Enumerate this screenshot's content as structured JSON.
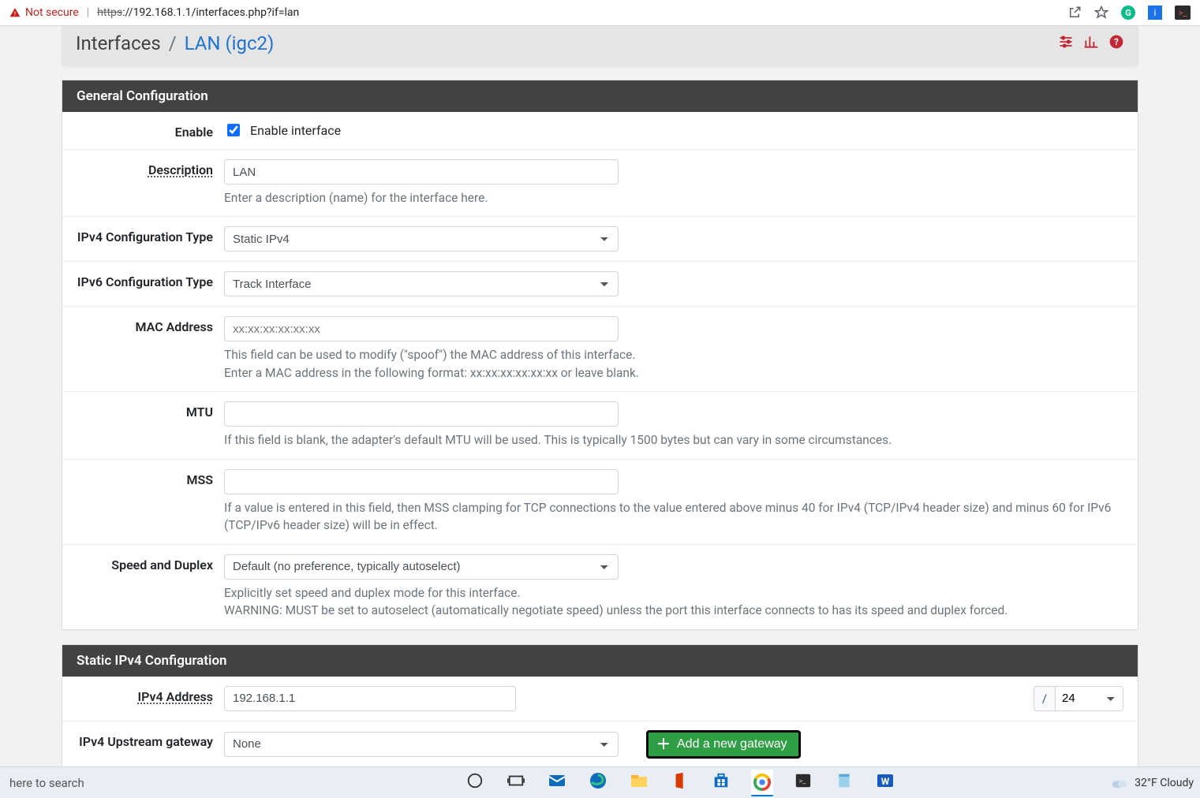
{
  "browser": {
    "security_text": "Not secure",
    "scheme": "https",
    "url_rest": "://192.168.1.1/interfaces.php?if=lan"
  },
  "breadcrumb": {
    "root": "Interfaces",
    "sep": "/",
    "current": "LAN (igc2)"
  },
  "panels": {
    "general": {
      "title": "General Configuration",
      "enable": {
        "label": "Enable",
        "checkbox_label": "Enable interface",
        "checked": true
      },
      "description": {
        "label": "Description",
        "value": "LAN",
        "help": "Enter a description (name) for the interface here."
      },
      "ipv4type": {
        "label": "IPv4 Configuration Type",
        "value": "Static IPv4"
      },
      "ipv6type": {
        "label": "IPv6 Configuration Type",
        "value": "Track Interface"
      },
      "mac": {
        "label": "MAC Address",
        "placeholder": "xx:xx:xx:xx:xx:xx",
        "help1": "This field can be used to modify (\"spoof\") the MAC address of this interface.",
        "help2": "Enter a MAC address in the following format: xx:xx:xx:xx:xx:xx or leave blank."
      },
      "mtu": {
        "label": "MTU",
        "help": "If this field is blank, the adapter's default MTU will be used. This is typically 1500 bytes but can vary in some circumstances."
      },
      "mss": {
        "label": "MSS",
        "help": "If a value is entered in this field, then MSS clamping for TCP connections to the value entered above minus 40 for IPv4 (TCP/IPv4 header size) and minus 60 for IPv6 (TCP/IPv6 header size) will be in effect."
      },
      "speed": {
        "label": "Speed and Duplex",
        "value": "Default (no preference, typically autoselect)",
        "help1": "Explicitly set speed and duplex mode for this interface.",
        "help2": "WARNING: MUST be set to autoselect (automatically negotiate speed) unless the port this interface connects to has its speed and duplex forced."
      }
    },
    "static4": {
      "title": "Static IPv4 Configuration",
      "ipv4addr": {
        "label": "IPv4 Address",
        "value": "192.168.1.1",
        "slash": "/",
        "cidr": "24"
      },
      "gateway": {
        "label": "IPv4 Upstream gateway",
        "value": "None",
        "button": "Add a new gateway"
      }
    }
  },
  "taskbar": {
    "search_hint": "here to search",
    "weather": "32°F  Cloudy"
  }
}
